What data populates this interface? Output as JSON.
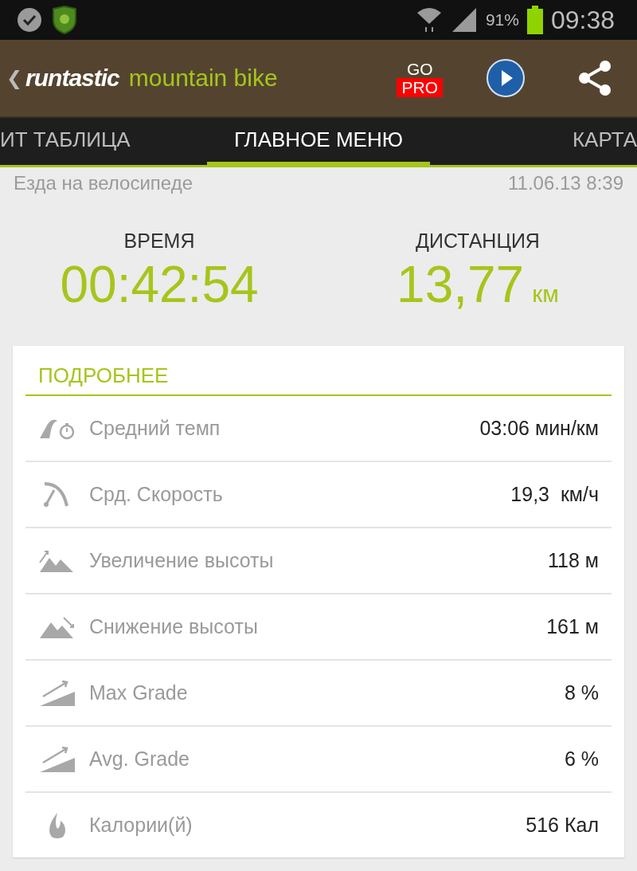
{
  "status_bar": {
    "battery_percent": "91%",
    "time": "09:38"
  },
  "app_bar": {
    "back": "❮",
    "logo_brand": "runtastic",
    "logo_product": "mountain bike",
    "promo_top": "GO",
    "promo_badge": "PRO"
  },
  "tabs": [
    {
      "label": "ИТ ТАБЛИЦА",
      "selected": false
    },
    {
      "label": "ГЛАВНОЕ МЕНЮ",
      "selected": true
    },
    {
      "label": "КАРТА",
      "selected": false
    }
  ],
  "activity": {
    "type": "Езда на велосипеде",
    "date": "11.06.13 8:39"
  },
  "summary": [
    {
      "label": "ВРЕМЯ",
      "value": "00:42:54"
    },
    {
      "label": "ДИСТАНЦИЯ",
      "value": "13,77",
      "unit": "км"
    }
  ],
  "details": {
    "title": "ПОДРОБНЕЕ",
    "rows": [
      {
        "kind": "pace",
        "label": "Средний темп",
        "value": "03:06 мин/км"
      },
      {
        "kind": "speed",
        "label": "Срд. Скорость",
        "value": "19,3  км/ч"
      },
      {
        "kind": "ascent",
        "label": "Увеличение высоты",
        "value": "118 м"
      },
      {
        "kind": "descent",
        "label": "Снижение высоты",
        "value": "161 м"
      },
      {
        "kind": "grade",
        "label": "Max Grade",
        "value": "8 %"
      },
      {
        "kind": "grade",
        "label": "Avg. Grade",
        "value": "6 %"
      },
      {
        "kind": "calories",
        "label": "Калории(й)",
        "value": "516 Кал"
      }
    ]
  }
}
